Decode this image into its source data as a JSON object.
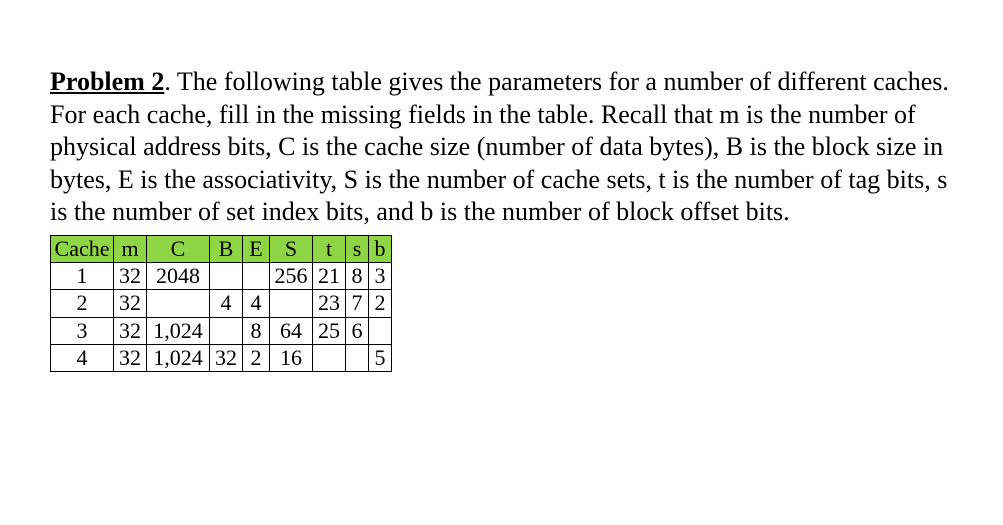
{
  "problem": {
    "title": "Problem 2",
    "text": ". The following table gives the parameters for a number of different caches. For each cache, fill in the missing fields in the table. Recall that m is the number of physical address bits, C is the cache size (number of data bytes), B is the block size in bytes, E is the associativity, S is the number of cache sets, t is the number of tag bits, s is the number of set index bits, and b is the number of block offset bits."
  },
  "table": {
    "headers": [
      "Cache",
      "m",
      "C",
      "B",
      "E",
      "S",
      "t",
      "s",
      "b"
    ],
    "rows": [
      {
        "cache": "1",
        "m": "32",
        "C": "2048",
        "B": "",
        "E": "",
        "S": "256",
        "t": "21",
        "s": "8",
        "b": "3"
      },
      {
        "cache": "2",
        "m": "32",
        "C": "",
        "B": "4",
        "E": "4",
        "S": "",
        "t": "23",
        "s": "7",
        "b": "2"
      },
      {
        "cache": "3",
        "m": "32",
        "C": "1,024",
        "B": "",
        "E": "8",
        "S": "64",
        "t": "25",
        "s": "6",
        "b": ""
      },
      {
        "cache": "4",
        "m": "32",
        "C": "1,024",
        "B": "32",
        "E": "2",
        "S": "16",
        "t": "",
        "s": "",
        "b": "5"
      }
    ]
  }
}
